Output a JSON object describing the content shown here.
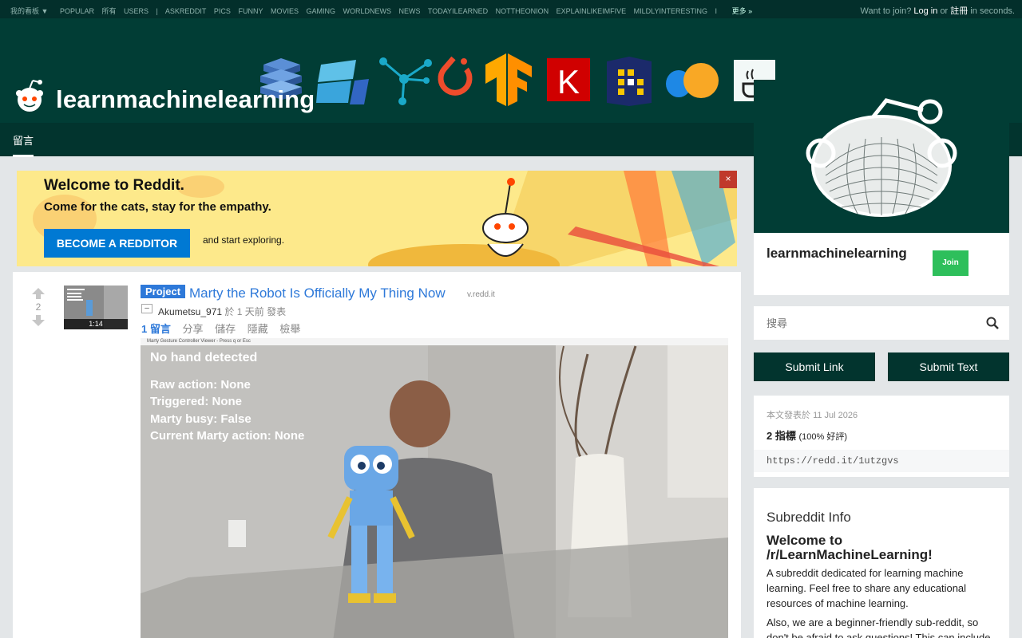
{
  "topbar": {
    "my_subreddits": "我的看板 ▼",
    "links": [
      "POPULAR",
      "所有",
      "USERS",
      "|",
      "ASKREDDIT",
      "PICS",
      "FUNNY",
      "MOVIES",
      "GAMING",
      "WORLDNEWS",
      "NEWS",
      "TODAYILEARNED",
      "NOTTHEONION",
      "EXPLAINLIKEIMFIVE",
      "MILDLYINTERESTING",
      "I"
    ],
    "more": "更多 »",
    "join_prompt": "Want to join?",
    "login": "Log in",
    "or": "or",
    "register": "註冊",
    "in_seconds": "in seconds."
  },
  "header": {
    "subreddit_name": "learnmachinelearning",
    "banner_icons": [
      "layers-logo-icon",
      "azure-ml-icon",
      "neural-graph-icon",
      "pytorch-icon",
      "tensorflow-icon",
      "keras-icon",
      "pandas-icon",
      "colab-icon",
      "coffee-icon"
    ]
  },
  "nav": {
    "tab": "留言"
  },
  "welcome": {
    "title": "Welcome to Reddit.",
    "subtitle": "Come for the cats, stay for the empathy.",
    "button": "BECOME A REDDITOR",
    "explore": "and start exploring.",
    "close": "×"
  },
  "post": {
    "score": "2",
    "thumbnail_duration": "1:14",
    "flair": "Project",
    "title": "Marty the Robot Is Officially My Thing Now",
    "domain": "v.redd.it",
    "expando": "–",
    "author": "Akumetsu_971",
    "posted_prefix": "於 ",
    "posted_time": "1 天前",
    "posted_suffix": " 發表",
    "actions": {
      "comments": "1 留言",
      "share": "分享",
      "save": "儲存",
      "hide": "隱藏",
      "report": "檢舉"
    },
    "video_overlay": {
      "window_title": "Marty Gesture Controller Viewer - Press q or Esc",
      "line1": "No hand detected",
      "line2": "Raw action: None",
      "line3": "Triggered: None",
      "line4": "Marty busy: False",
      "line5": "Current Marty action: None"
    }
  },
  "sidebar": {
    "subreddit_name": "learnmachinelearning",
    "join": "Join",
    "search_placeholder": "搜尋",
    "submit_link": "Submit Link",
    "submit_text": "Submit Text",
    "posted_on_label": "本文發表於 ",
    "posted_on_date": "11 Jul 2026",
    "points": "2 指標",
    "upvoted_pct": "(100% 好評)",
    "shortlink": "https://redd.it/1utzgvs",
    "about_heading": "Subreddit Info",
    "welcome_heading": "Welcome to /r/LearnMachineLearning!",
    "description": "A subreddit dedicated for learning machine learning. Feel free to share any educational resources of machine learning.",
    "description2": "Also, we are a beginner-friendly sub-reddit, so don't be afraid to ask questions! This can include"
  },
  "colors": {
    "header_bg": "#013d35",
    "topbar_bg": "#032f2b",
    "link_blue": "#2e79d9",
    "join_green": "#2ebf5b",
    "redditor_button": "#0079d3"
  }
}
